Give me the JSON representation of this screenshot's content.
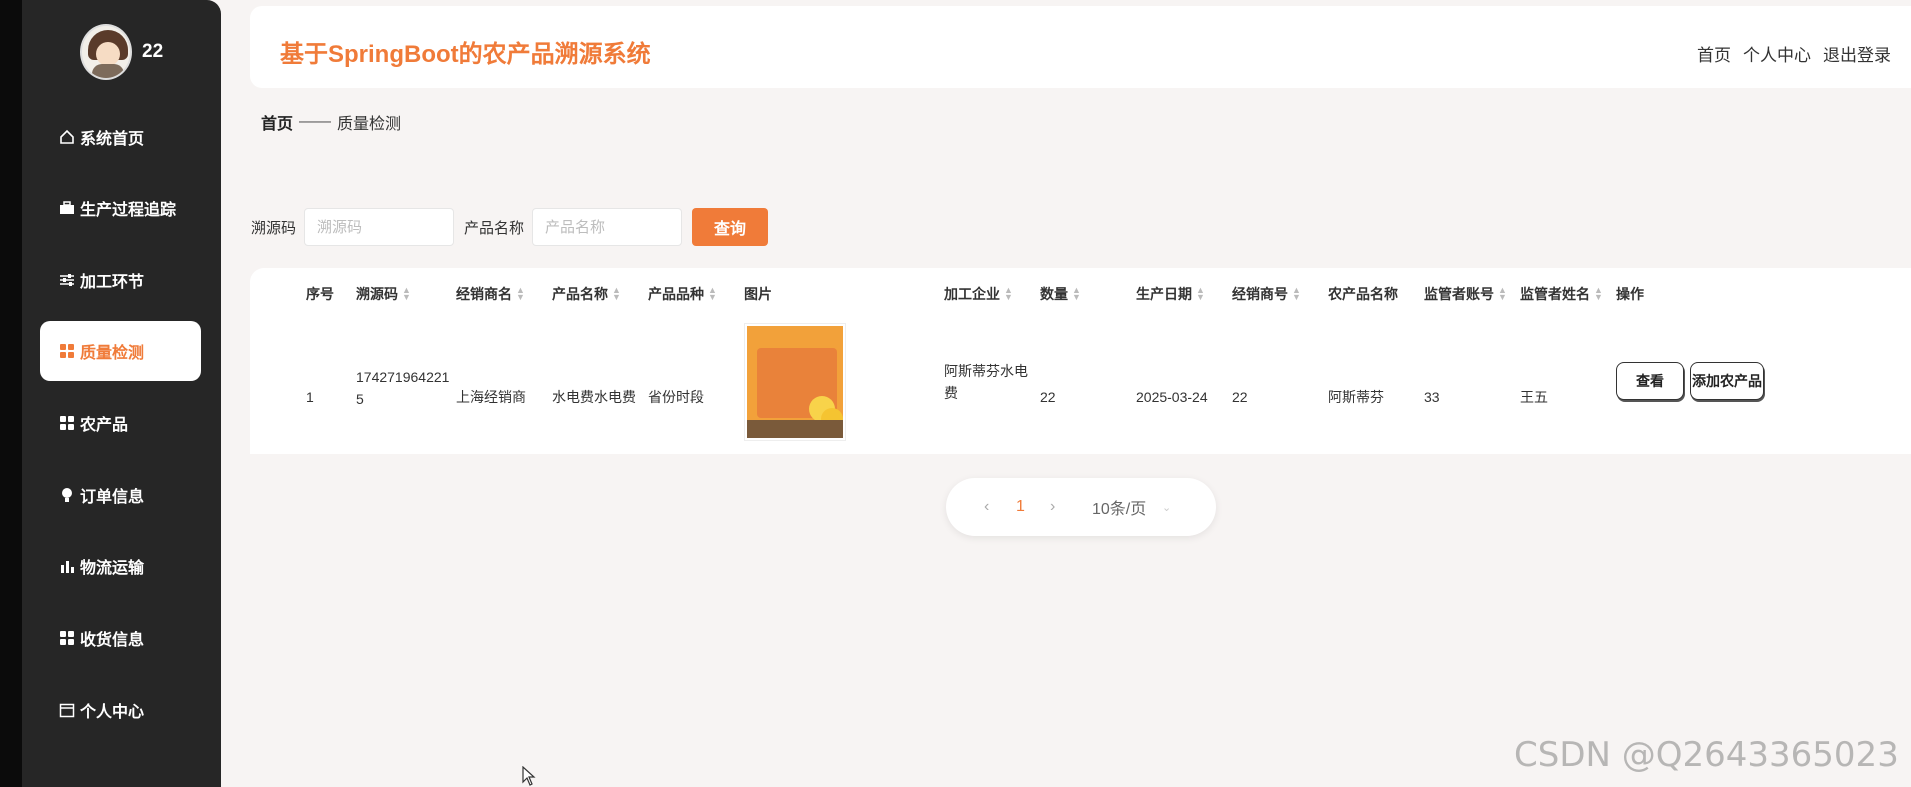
{
  "user": {
    "name": "22"
  },
  "sidebar": {
    "items": [
      {
        "label": "系统首页",
        "icon": "home-icon"
      },
      {
        "label": "生产过程追踪",
        "icon": "briefcase-icon"
      },
      {
        "label": "加工环节",
        "icon": "sliders-icon"
      },
      {
        "label": "质量检测",
        "icon": "grid-icon",
        "active": true
      },
      {
        "label": "农产品",
        "icon": "grid-icon"
      },
      {
        "label": "订单信息",
        "icon": "bulb-icon"
      },
      {
        "label": "物流运输",
        "icon": "bar-chart-icon"
      },
      {
        "label": "收货信息",
        "icon": "grid-icon"
      },
      {
        "label": "个人中心",
        "icon": "calendar-icon"
      }
    ]
  },
  "header": {
    "title": "基于SpringBoot的农产品溯源系统",
    "links": {
      "home": "首页",
      "profile": "个人中心",
      "logout": "退出登录"
    }
  },
  "breadcrumb": {
    "home": "首页",
    "separator": "——",
    "current": "质量检测"
  },
  "search": {
    "trace_code_label": "溯源码",
    "trace_code_placeholder": "溯源码",
    "product_name_label": "产品名称",
    "product_name_placeholder": "产品名称",
    "button_label": "查询"
  },
  "table": {
    "headers": {
      "index": "序号",
      "trace_code": "溯源码",
      "dealer_name": "经销商名",
      "product_name": "产品名称",
      "product_variety": "产品品种",
      "image": "图片",
      "processor": "加工企业",
      "quantity": "数量",
      "production_date": "生产日期",
      "dealer_account": "经销商号",
      "agri_product_name": "农产品名称",
      "supervisor_account": "监管者账号",
      "supervisor_name": "监管者姓名",
      "actions": "操作"
    },
    "rows": [
      {
        "index": "1",
        "trace_code_line1": "174271964221",
        "trace_code_line2": "5",
        "dealer_name": "上海经销商",
        "product_name": "水电费水电费",
        "product_variety": "省份时段",
        "processor_line1": "阿斯蒂芬水电",
        "processor_line2": "费",
        "quantity": "22",
        "production_date": "2025-03-24",
        "dealer_account": "22",
        "agri_product_name": "阿斯蒂芬",
        "supervisor_account": "33",
        "supervisor_name": "王五",
        "view_label": "查看",
        "add_label": "添加农产品"
      }
    ]
  },
  "pagination": {
    "prev": "‹",
    "current_page": "1",
    "next": "›",
    "page_size": "10条/页",
    "size_arrow": "⌄"
  },
  "watermark": "CSDN @Q2643365023",
  "colors": {
    "accent": "#f07b39",
    "sidebar_bg": "#262626",
    "page_bg": "#f7f4f3"
  }
}
